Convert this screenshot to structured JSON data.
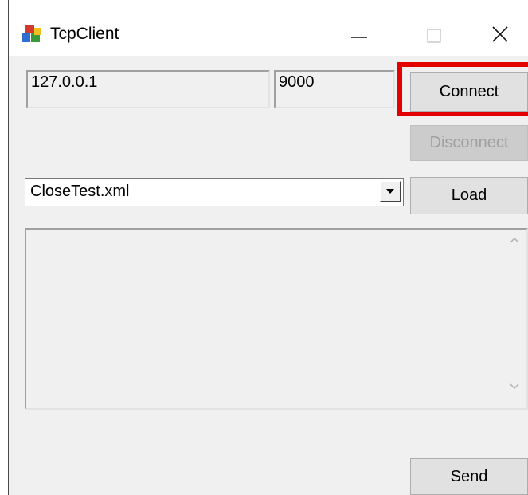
{
  "window": {
    "title": "TcpClient",
    "icons": {
      "app": "application-icon",
      "minimize": "minimize-icon",
      "maximize": "maximize-icon",
      "close": "close-icon"
    }
  },
  "connection": {
    "ip_value": "127.0.0.1",
    "port_value": "9000",
    "connect_label": "Connect",
    "disconnect_label": "Disconnect"
  },
  "file": {
    "selected": "CloseTest.xml",
    "load_label": "Load"
  },
  "message": {
    "content": "",
    "send_label": "Send"
  },
  "colors": {
    "highlight": "#e30000",
    "window_bg": "#f0f0f0"
  }
}
